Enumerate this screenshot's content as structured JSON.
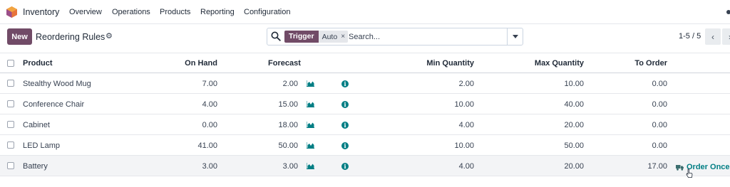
{
  "app": {
    "title": "Inventory",
    "menu": [
      "Overview",
      "Operations",
      "Products",
      "Reporting",
      "Configuration"
    ],
    "brand_color": "#714B67",
    "accent_color": "#017e84"
  },
  "control_panel": {
    "new_label": "New",
    "page_title": "Reordering Rules",
    "search": {
      "facet_label": "Trigger",
      "facet_value": "Auto",
      "placeholder": "Search..."
    },
    "pager": "1-5 / 5"
  },
  "table": {
    "columns": [
      "Product",
      "On Hand",
      "Forecast",
      "Min Quantity",
      "Max Quantity",
      "To Order"
    ],
    "rows": [
      {
        "product": "Stealthy Wood Mug",
        "on_hand": "7.00",
        "forecast": "2.00",
        "min_qty": "2.00",
        "max_qty": "10.00",
        "to_order": "0.00"
      },
      {
        "product": "Conference Chair",
        "on_hand": "4.00",
        "forecast": "15.00",
        "min_qty": "10.00",
        "max_qty": "40.00",
        "to_order": "0.00"
      },
      {
        "product": "Cabinet",
        "on_hand": "0.00",
        "forecast": "18.00",
        "min_qty": "4.00",
        "max_qty": "20.00",
        "to_order": "0.00"
      },
      {
        "product": "LED Lamp",
        "on_hand": "41.00",
        "forecast": "50.00",
        "min_qty": "10.00",
        "max_qty": "50.00",
        "to_order": "0.00"
      },
      {
        "product": "Battery",
        "on_hand": "3.00",
        "forecast": "3.00",
        "min_qty": "4.00",
        "max_qty": "20.00",
        "to_order": "17.00",
        "action": "Order Once"
      }
    ]
  },
  "icons": [
    "app-logo-icon",
    "gear-icon",
    "search-icon",
    "remove-facet-icon",
    "dropdown-caret-icon",
    "chevron-left-icon",
    "chevron-right-icon",
    "forecast-graph-icon",
    "info-icon",
    "truck-icon",
    "pointer-cursor-icon"
  ]
}
